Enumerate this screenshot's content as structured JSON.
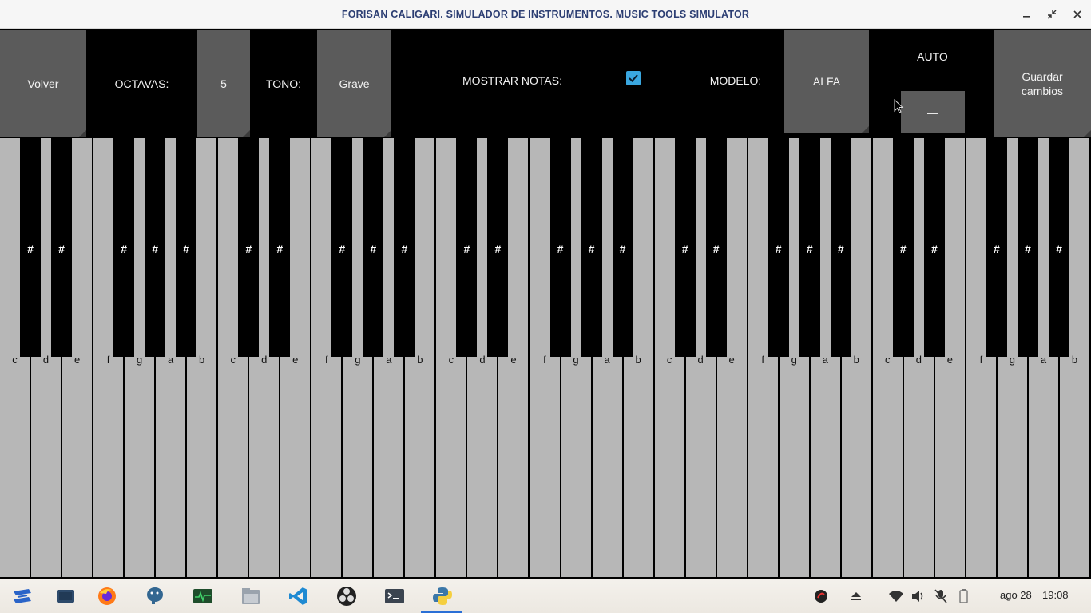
{
  "window": {
    "title": "FORISAN CALIGARI. SIMULADOR DE INSTRUMENTOS. MUSIC TOOLS SIMULATOR",
    "controls": [
      "minimize-icon",
      "restore-icon",
      "close-icon"
    ]
  },
  "toolbar": {
    "back_label": "Volver",
    "octaves_label": "OCTAVAS:",
    "octaves_value": "5",
    "tone_label": "TONO:",
    "tone_value": "Grave",
    "show_notes_label": "MOSTRAR NOTAS:",
    "show_notes_checked": true,
    "model_label": "MODELO:",
    "model_value": "ALFA",
    "auto_label": "AUTO",
    "auto_value": "—",
    "save_label": "Guardar cambios"
  },
  "keyboard": {
    "octaves": 5,
    "white_notes": [
      "c",
      "d",
      "e",
      "f",
      "g",
      "a",
      "b"
    ],
    "sharp_label": "#",
    "white_color": "#b7b7b7",
    "black_color": "#000000"
  },
  "taskbar": {
    "apps": [
      "zorin-menu-icon",
      "workspace-icon",
      "firefox-icon",
      "postgresql-icon",
      "system-monitor-icon",
      "files-icon",
      "vscode-icon",
      "obs-icon",
      "terminal-icon",
      "python-icon"
    ],
    "tray_icons": [
      "media-icon",
      "eject-icon",
      "wifi-icon",
      "volume-icon",
      "mic-muted-icon",
      "battery-icon"
    ],
    "date": "ago 28",
    "time": "19:08",
    "accent": "#2a6fd6"
  }
}
